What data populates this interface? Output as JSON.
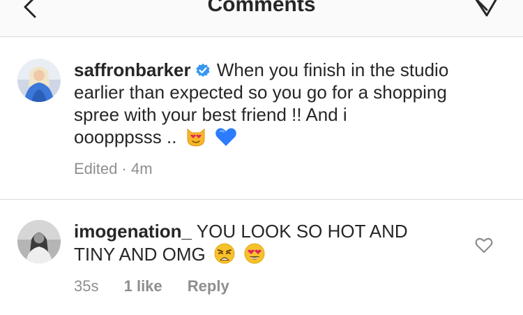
{
  "header": {
    "title": "Comments",
    "back_icon": "chevron-left-icon",
    "send_icon": "direct-send-icon"
  },
  "caption": {
    "username": "saffronbarker",
    "verified": true,
    "line1": "When you finish in the studio",
    "line2": "earlier than expected so you go for a shopping",
    "line3": "spree with your best friend !! And i",
    "line4": "ooopppsss ..",
    "emojis": [
      "smiling-cat-heart-eyes-emoji",
      "blue-heart-emoji"
    ],
    "edited": "Edited",
    "separator": "·",
    "time": "4m"
  },
  "comment": {
    "username": "imogenation_",
    "line1": "YOU LOOK SO HOT AND",
    "line2": "TINY AND OMG",
    "emojis": [
      "weary-face-emoji",
      "heart-eyes-emoji"
    ],
    "time": "35s",
    "likes": "1 like",
    "reply": "Reply"
  },
  "colors": {
    "text": "#262626",
    "secondary": "#8e8e8e",
    "verified_blue": "#3897f0",
    "header_bg": "#fafafa",
    "divider": "#dbdbdb"
  }
}
